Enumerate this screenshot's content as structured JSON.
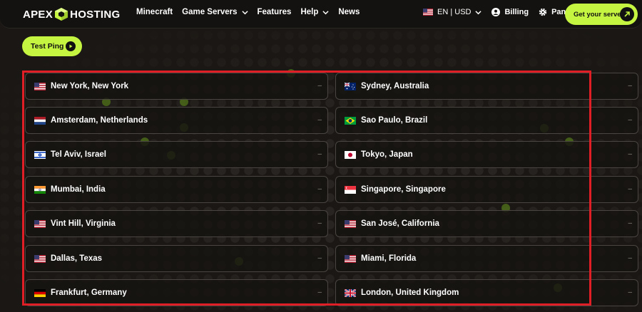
{
  "brand": {
    "name_left": "APEX",
    "name_right": "HOSTING"
  },
  "nav": [
    {
      "label": "Minecraft",
      "dropdown": false
    },
    {
      "label": "Game Servers",
      "dropdown": true
    },
    {
      "label": "Features",
      "dropdown": false
    },
    {
      "label": "Help",
      "dropdown": true
    },
    {
      "label": "News",
      "dropdown": false
    }
  ],
  "header_right": {
    "lang": "EN | USD",
    "billing": "Billing",
    "panel": "Panel",
    "cta": "Get your server"
  },
  "ping_button": "Test Ping",
  "servers_left": [
    {
      "flag": "us",
      "name": "New York, New York",
      "ping": "–"
    },
    {
      "flag": "nl",
      "name": "Amsterdam, Netherlands",
      "ping": "–"
    },
    {
      "flag": "il",
      "name": "Tel Aviv, Israel",
      "ping": "–"
    },
    {
      "flag": "in",
      "name": "Mumbai, India",
      "ping": "–"
    },
    {
      "flag": "us",
      "name": "Vint Hill, Virginia",
      "ping": "–"
    },
    {
      "flag": "us",
      "name": "Dallas, Texas",
      "ping": "–"
    },
    {
      "flag": "de",
      "name": "Frankfurt, Germany",
      "ping": "–"
    }
  ],
  "servers_right": [
    {
      "flag": "au",
      "name": "Sydney, Australia",
      "ping": "–"
    },
    {
      "flag": "br",
      "name": "Sao Paulo, Brazil",
      "ping": "–"
    },
    {
      "flag": "jp",
      "name": "Tokyo, Japan",
      "ping": "–"
    },
    {
      "flag": "sg",
      "name": "Singapore, Singapore",
      "ping": "–"
    },
    {
      "flag": "us",
      "name": "San José, California",
      "ping": "–"
    },
    {
      "flag": "us",
      "name": "Miami, Florida",
      "ping": "–"
    },
    {
      "flag": "gb",
      "name": "London, United Kingdom",
      "ping": "–"
    }
  ],
  "colors": {
    "accent": "#c5f541",
    "background": "#1a1714",
    "highlight": "#e01e26"
  }
}
